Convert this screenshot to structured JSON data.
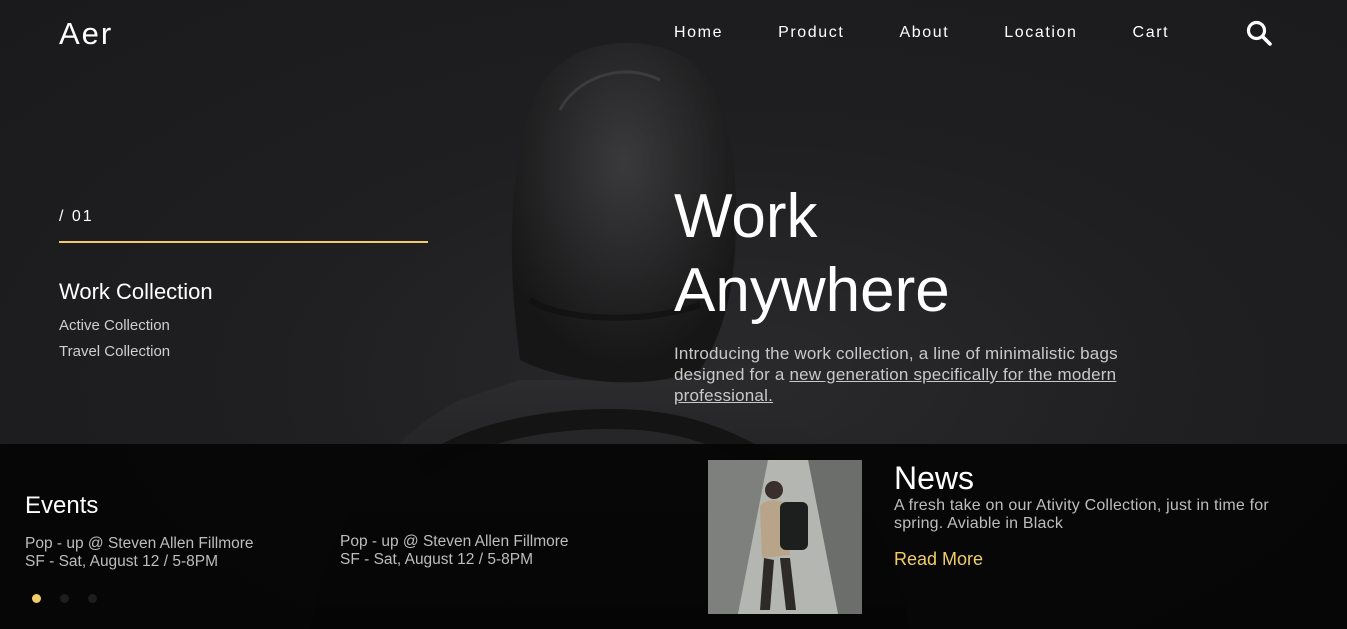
{
  "brand": {
    "logo": "Aer"
  },
  "nav": {
    "items": [
      {
        "label": "Home"
      },
      {
        "label": "Product"
      },
      {
        "label": "About"
      },
      {
        "label": "Location"
      },
      {
        "label": "Cart"
      }
    ],
    "search_icon": "search-icon"
  },
  "slider": {
    "index": "/ 01",
    "collection_title": "Work Collection",
    "collections": [
      "Active Collection",
      "Travel Collection"
    ]
  },
  "hero": {
    "headline_line1": "Work",
    "headline_line2": "Anywhere",
    "intro_text": "Introducing the work collection, a line of minimalistic bags designed for a ",
    "intro_link": "new generation specifically for the modern professional."
  },
  "events": {
    "title": "Events",
    "items": [
      {
        "line1": "Pop - up @ Steven Allen Fillmore",
        "line2": "SF - Sat, August 12 / 5-8PM"
      },
      {
        "line1": "Pop - up @ Steven Allen Fillmore",
        "line2": "SF - Sat, August 12 / 5-8PM"
      }
    ],
    "dots_count": 3,
    "active_dot": 1
  },
  "news": {
    "title": "News",
    "text": "A fresh take on our Ativity Collection, just in time for spring. Aviable in Black",
    "read_more": "Read More"
  },
  "colors": {
    "accent": "#f2cc6b",
    "background": "#1e1e20",
    "band": "#040404"
  }
}
